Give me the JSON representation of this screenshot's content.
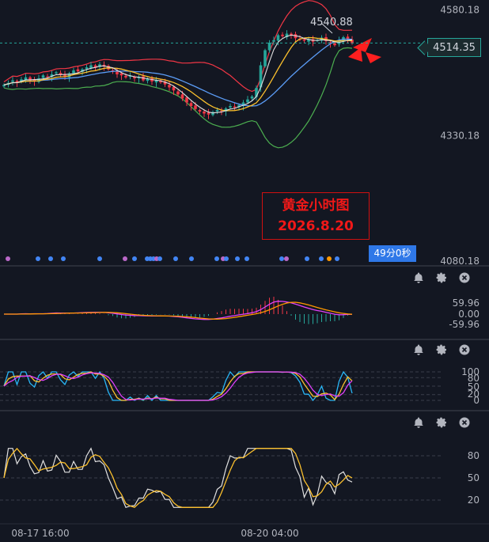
{
  "chart_data": [
    {
      "type": "line",
      "pane": "main",
      "description_text": "",
      "title": "",
      "y_ticks": [
        4580.18,
        4330.18,
        4080.18
      ],
      "ylim": [
        4080.18,
        4600
      ],
      "current_price": "4514.35",
      "high_label": "4540.88",
      "annotation_lines": [
        "黄金小时图",
        "2026.8.20"
      ],
      "timer": "49分0秒",
      "x_ticks": [
        "08-17 16:00",
        "08-20 04:00"
      ],
      "series": [
        {
          "name": "",
          "color": "#f23645",
          "role": "upper-band"
        },
        {
          "name": "",
          "color": "#4caf50",
          "role": "lower-band"
        },
        {
          "name": "",
          "color": "#e0e0e0",
          "role": "fast-ma"
        },
        {
          "name": "",
          "color": "#fbc02d",
          "role": "mid-ma"
        },
        {
          "name": "",
          "color": "#5b9cf6",
          "role": "slow-ma"
        }
      ],
      "close": [
        4431,
        4435,
        4440,
        4436,
        4442,
        4446,
        4440,
        4438,
        4444,
        4450,
        4447,
        4452,
        4456,
        4451,
        4448,
        4454,
        4460,
        4458,
        4462,
        4466,
        4470,
        4465,
        4472,
        4468,
        4462,
        4458,
        4452,
        4450,
        4446,
        4449,
        4444,
        4446,
        4440,
        4443,
        4438,
        4440,
        4436,
        4432,
        4426,
        4420,
        4412,
        4404,
        4396,
        4389,
        4383,
        4378,
        4374,
        4372,
        4377,
        4381,
        4378,
        4384,
        4389,
        4386,
        4391,
        4396,
        4402,
        4408,
        4425,
        4470,
        4500,
        4515,
        4520,
        4530,
        4528,
        4533,
        4530,
        4524,
        4521,
        4519,
        4522,
        4517,
        4520,
        4525,
        4518,
        4514,
        4510,
        4520,
        4526,
        4523,
        4514
      ]
    },
    {
      "type": "line",
      "pane": "macd",
      "y_ticks": [
        "59.96",
        "0.00",
        "-59.96"
      ],
      "series_colors": [
        "#e040fb",
        "#ff9800"
      ],
      "histogram_colors": [
        "#f23645",
        "#26a69a"
      ]
    },
    {
      "type": "line",
      "pane": "kdj",
      "y_ticks": [
        "100",
        "80",
        "50",
        "20",
        "0"
      ],
      "series_colors": [
        "#29b6f6",
        "#fbc02d",
        "#e040fb"
      ]
    },
    {
      "type": "line",
      "pane": "rsi",
      "y_ticks": [
        "80",
        "50",
        "20"
      ],
      "series_colors": [
        "#e0e0e0",
        "#fbc02d"
      ]
    }
  ]
}
